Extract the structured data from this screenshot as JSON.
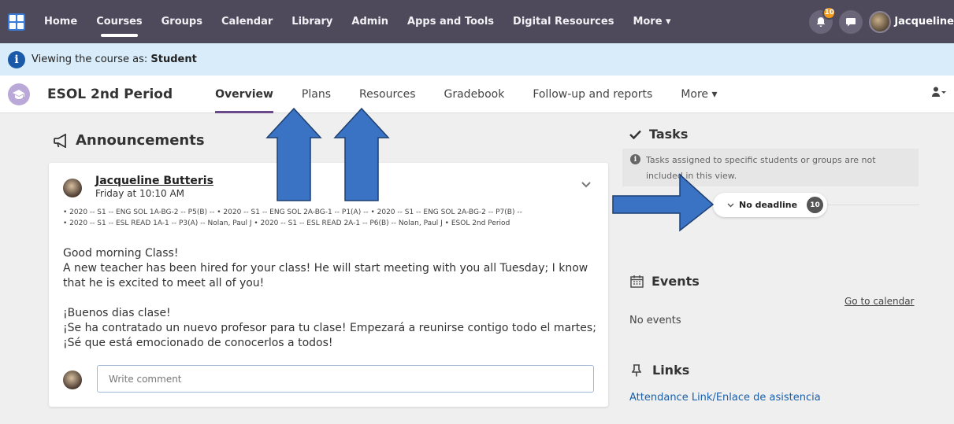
{
  "topnav": {
    "items": [
      "Home",
      "Courses",
      "Groups",
      "Calendar",
      "Library",
      "Admin",
      "Apps and Tools",
      "Digital Resources",
      "More ▾"
    ],
    "active_index": 1,
    "notification_count": "10",
    "user_name": "Jacqueline"
  },
  "banner": {
    "prefix": "Viewing the course as:",
    "role": "Student"
  },
  "course": {
    "title": "ESOL 2nd Period",
    "tabs": [
      "Overview",
      "Plans",
      "Resources",
      "Gradebook",
      "Follow-up and reports",
      "More ▾"
    ],
    "active_tab": 0
  },
  "announcements": {
    "heading": "Announcements",
    "post": {
      "author": "Jacqueline Butteris",
      "time": "Friday at 10:10 AM",
      "groups_line1": "• 2020 -- S1 -- ENG SOL 1A-BG-2 -- P5(B) --    • 2020 -- S1 -- ENG SOL 2A-BG-1 -- P1(A) --    • 2020 -- S1 -- ENG SOL 2A-BG-2 -- P7(B) --",
      "groups_line2": "• 2020 -- S1 -- ESL READ 1A-1 -- P3(A) -- Nolan, Paul J    • 2020 -- S1 -- ESL READ 2A-1 -- P6(B) -- Nolan, Paul J    • ESOL 2nd Period",
      "p1_line1": "Good morning Class!",
      "p1_line2": "A new teacher has been hired for your class! He will start meeting with you all Tuesday; I know that he is excited to meet all of you!",
      "p2_line1": "¡Buenos dias clase!",
      "p2_line2": "¡Se ha contratado un nuevo profesor para tu clase! Empezará a reunirse contigo todo el martes; ¡Sé que está emocionado de conocerlos a todos!"
    },
    "comment_placeholder": "Write comment"
  },
  "tasks": {
    "heading": "Tasks",
    "note": "Tasks assigned to specific students or groups are not included in this view.",
    "deadline_label": "No deadline",
    "deadline_count": "10"
  },
  "events": {
    "heading": "Events",
    "go_to_calendar": "Go to calendar",
    "empty": "No events"
  },
  "links": {
    "heading": "Links",
    "items": [
      "Attendance Link/Enlace de asistencia"
    ]
  },
  "colors": {
    "nav_bg": "#4e4a5c",
    "banner_bg": "#d9ecf9",
    "arrow_fill": "#3a72c4",
    "link": "#1a5fa8"
  }
}
